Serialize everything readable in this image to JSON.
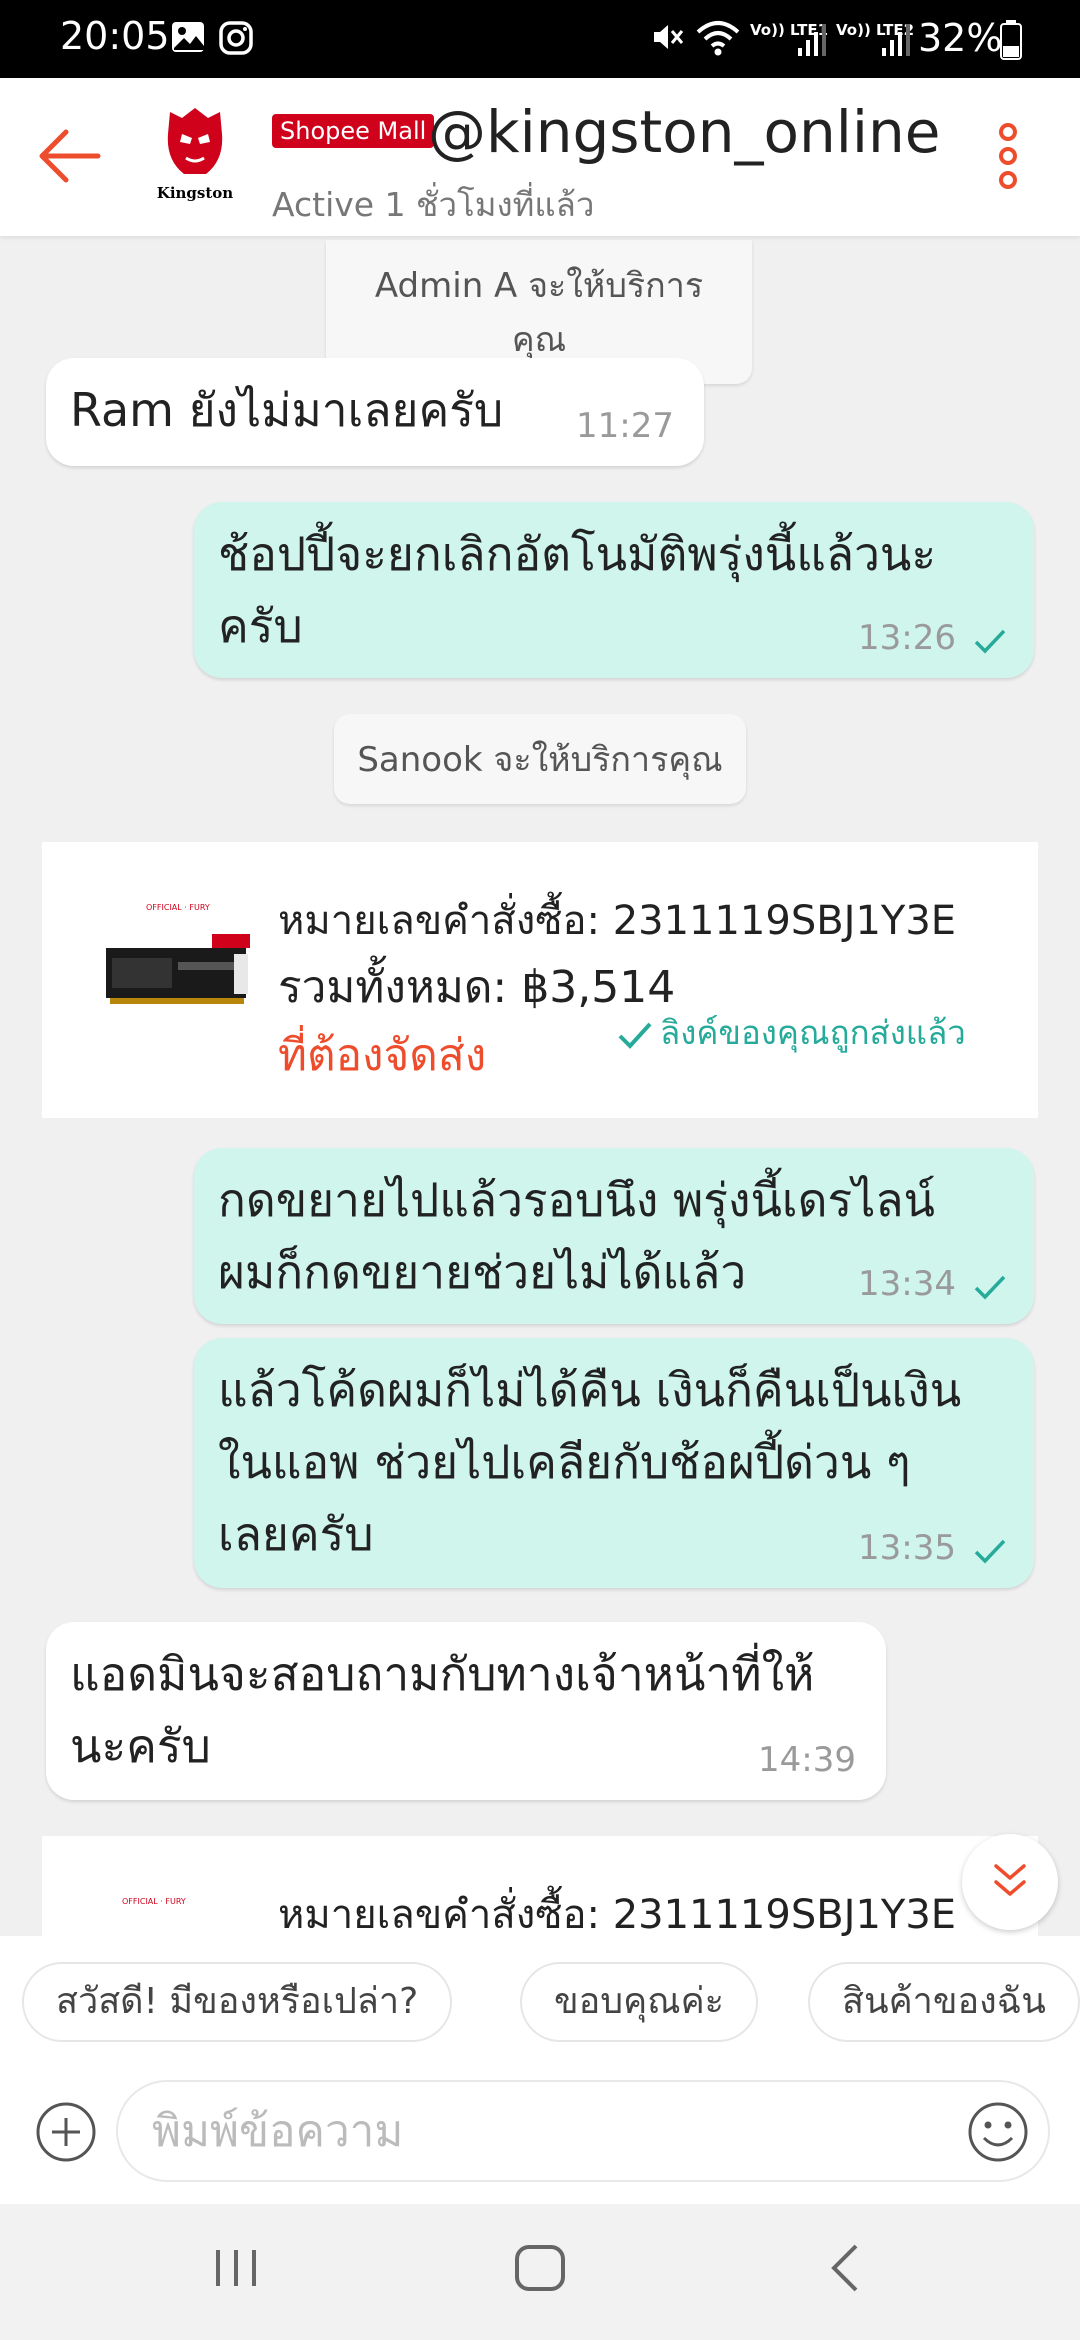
{
  "status_bar": {
    "time": "20:05",
    "lte1": "Vo)) LTE1",
    "lte2": "Vo)) LTE2",
    "battery": "32%"
  },
  "header": {
    "badge": "Shopee Mall",
    "shop_name": "@kingston_online",
    "active_status": "Active 1 ชั่วโมงที่แล้ว",
    "brand_caption": "Kingston"
  },
  "messages": {
    "sys1": "Admin A จะให้บริการคุณ",
    "m1": {
      "text": "Ram ยังไม่มาเลยครับ",
      "time": "11:27"
    },
    "m2": {
      "text": "ช้อปปี้จะยกเลิกอัตโนมัติพรุ่งนี้แล้วนะครับ",
      "time": "13:26"
    },
    "sys2": "Sanook จะให้บริการคุณ",
    "order1": {
      "order_no": "หมายเลขคำสั่งซื้อ: 2311119SBJ1Y3E",
      "total": "รวมทั้งหมด: ฿3,514",
      "status": "ที่ต้องจัดส่ง",
      "link_sent": "ลิงค์ของคุณถูกส่งแล้ว"
    },
    "m3": {
      "text": "กดขยายไปแล้วรอบนึง พรุ่งนี้เดรไลน์ ผมก็กดขยายช่วยไม่ได้แล้ว",
      "time": "13:34"
    },
    "m4": {
      "text": "แล้วโค้ดผมก็ไม่ได้คืน เงินก็คืนเป็นเงินในแอพ ช่วยไปเคลียกับช้อผปี้ด่วน ๆ เลยครับ",
      "time": "13:35"
    },
    "m5": {
      "text": "แอดมินจะสอบถามกับทางเจ้าหน้าที่ให้นะครับ",
      "time": "14:39"
    },
    "order2": {
      "order_no": "หมายเลขคำสั่งซื้อ: 2311119SBJ1Y3E"
    }
  },
  "quick_replies": [
    "สวัสดี! มีของหรือเปล่า?",
    "ขอบคุณค่ะ",
    "สินค้าของฉัน"
  ],
  "input": {
    "placeholder": "พิมพ์ข้อความ"
  },
  "colors": {
    "accent": "#ee4d2d",
    "outgoing_bubble": "#cff5ec",
    "tick": "#26aa99",
    "mall_badge": "#d0011b"
  }
}
